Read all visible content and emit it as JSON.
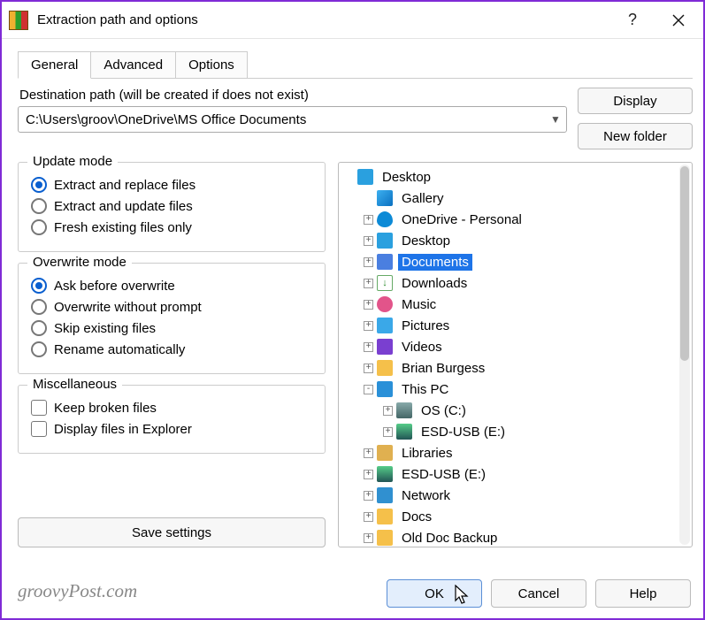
{
  "title": "Extraction path and options",
  "tabs": {
    "general": "General",
    "advanced": "Advanced",
    "options": "Options"
  },
  "path_caption": "Destination path (will be created if does not exist)",
  "path_value": "C:\\Users\\groov\\OneDrive\\MS Office Documents",
  "buttons": {
    "display": "Display",
    "newfolder": "New folder",
    "savesettings": "Save settings",
    "ok": "OK",
    "cancel": "Cancel",
    "help": "Help"
  },
  "groups": {
    "update": {
      "title": "Update mode",
      "opts": {
        "replace": "Extract and replace files",
        "update": "Extract and update files",
        "fresh": "Fresh existing files only"
      }
    },
    "overwrite": {
      "title": "Overwrite mode",
      "opts": {
        "ask": "Ask before overwrite",
        "ow": "Overwrite without prompt",
        "skip": "Skip existing files",
        "rename": "Rename automatically"
      }
    },
    "misc": {
      "title": "Miscellaneous",
      "opts": {
        "broken": "Keep broken files",
        "explorer": "Display files in Explorer"
      }
    }
  },
  "tree": [
    {
      "d": 0,
      "exp": "",
      "ic": "i-desktop",
      "t": "Desktop"
    },
    {
      "d": 1,
      "exp": "",
      "ic": "i-gallery",
      "t": "Gallery"
    },
    {
      "d": 1,
      "exp": "+",
      "ic": "i-onedrive",
      "t": "OneDrive - Personal"
    },
    {
      "d": 1,
      "exp": "+",
      "ic": "i-desktop",
      "t": "Desktop"
    },
    {
      "d": 1,
      "exp": "+",
      "ic": "i-docs",
      "t": "Documents",
      "sel": true
    },
    {
      "d": 1,
      "exp": "+",
      "ic": "i-dl",
      "t": "Downloads"
    },
    {
      "d": 1,
      "exp": "+",
      "ic": "i-music",
      "t": "Music"
    },
    {
      "d": 1,
      "exp": "+",
      "ic": "i-pic",
      "t": "Pictures"
    },
    {
      "d": 1,
      "exp": "+",
      "ic": "i-video",
      "t": "Videos"
    },
    {
      "d": 1,
      "exp": "+",
      "ic": "i-folder",
      "t": "Brian Burgess"
    },
    {
      "d": 1,
      "exp": "-",
      "ic": "i-pc",
      "t": "This PC"
    },
    {
      "d": 2,
      "exp": "+",
      "ic": "i-drive",
      "t": "OS (C:)"
    },
    {
      "d": 2,
      "exp": "+",
      "ic": "i-usb",
      "t": "ESD-USB (E:)"
    },
    {
      "d": 1,
      "exp": "+",
      "ic": "i-lib",
      "t": "Libraries"
    },
    {
      "d": 1,
      "exp": "+",
      "ic": "i-usb",
      "t": "ESD-USB (E:)"
    },
    {
      "d": 1,
      "exp": "+",
      "ic": "i-net",
      "t": "Network"
    },
    {
      "d": 1,
      "exp": "+",
      "ic": "i-folder",
      "t": "Docs"
    },
    {
      "d": 1,
      "exp": "+",
      "ic": "i-folder",
      "t": "Old Doc Backup"
    }
  ],
  "watermark": "groovyPost.com"
}
